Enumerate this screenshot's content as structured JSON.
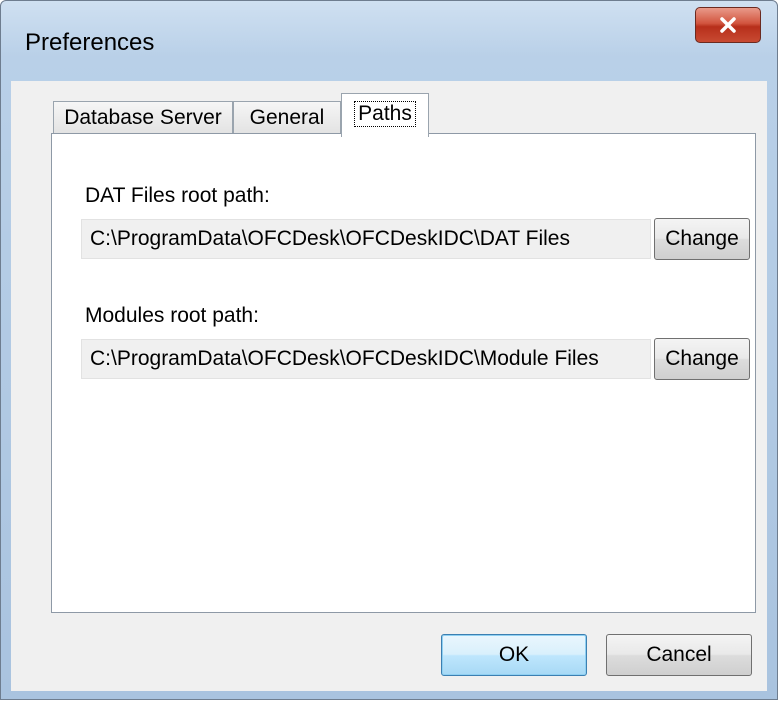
{
  "window": {
    "title": "Preferences"
  },
  "tabs": [
    {
      "label": "Database Server",
      "active": false
    },
    {
      "label": "General",
      "active": false
    },
    {
      "label": "Paths",
      "active": true
    }
  ],
  "paths": {
    "dat_label": "DAT Files root path:",
    "dat_value": "C:\\ProgramData\\OFCDesk\\OFCDeskIDC\\DAT Files",
    "dat_change": "Change",
    "modules_label": "Modules root path:",
    "modules_value": "C:\\ProgramData\\OFCDesk\\OFCDeskIDC\\Module Files",
    "modules_change": "Change"
  },
  "footer": {
    "ok_label": "OK",
    "cancel_label": "Cancel"
  },
  "icons": {
    "close": "close-icon"
  },
  "colors": {
    "close_button": "#c84a32",
    "default_button_border": "#3c7fb1"
  }
}
